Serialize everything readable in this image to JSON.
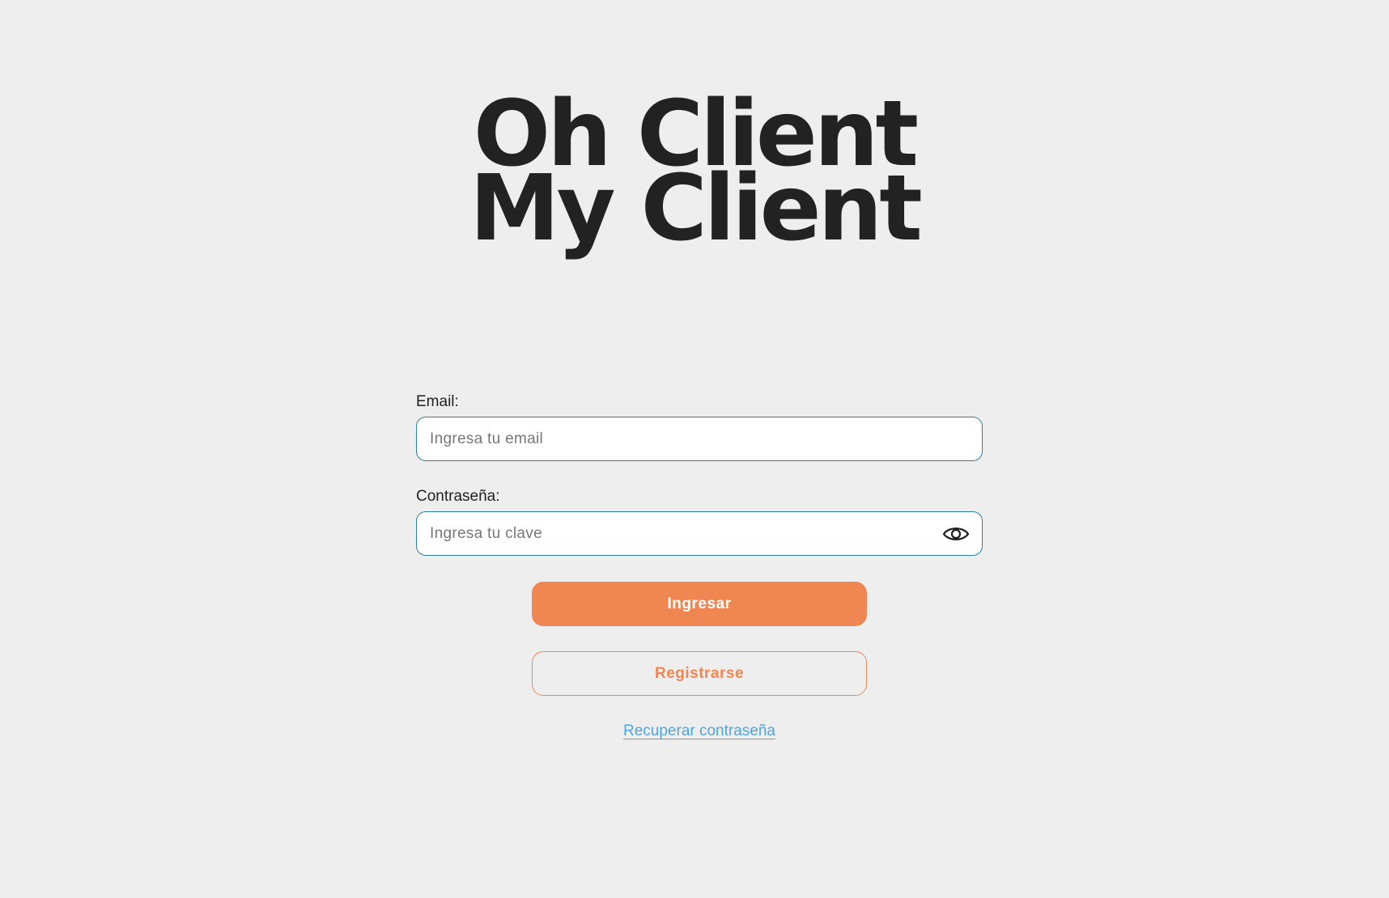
{
  "logo": {
    "line1": "Oh Client",
    "line2": "My Client"
  },
  "login_form": {
    "email": {
      "label": "Email:",
      "placeholder": "Ingresa tu email",
      "value": ""
    },
    "password": {
      "label": "Contraseña:",
      "placeholder": "Ingresa tu clave",
      "value": "",
      "toggle_icon": "eye-icon"
    },
    "submit_label": "Ingresar",
    "register_label": "Registrarse",
    "recover_link": "Recuperar contraseña"
  },
  "colors": {
    "background": "#eeeeee",
    "accent": "#f08752",
    "input_border": "#2f7da0",
    "link": "#4da6df",
    "text": "#1f1f1f"
  }
}
